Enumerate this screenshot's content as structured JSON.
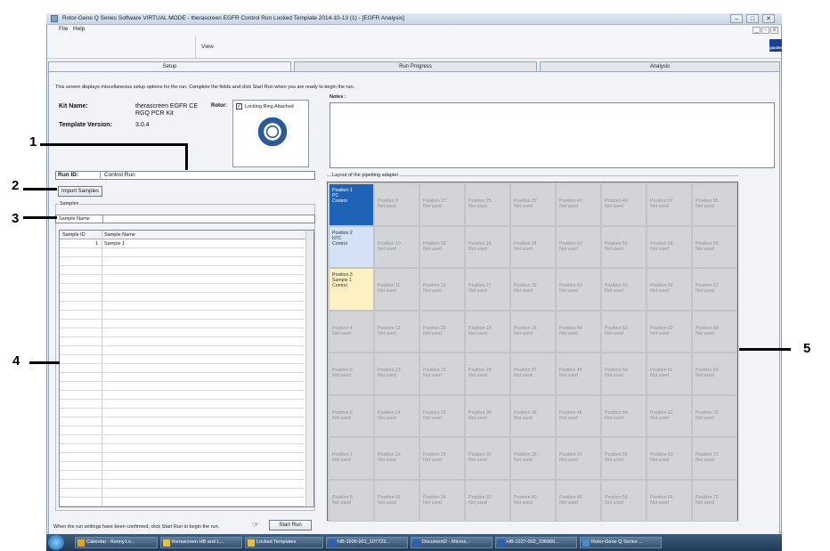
{
  "window": {
    "title": "Rotor-Gene Q Series Software VIRTUAL MODE - therascreen EGFR Control Run Locked Template 2014-10-13 (1) - [EGFR Analysis]",
    "minimize": "–",
    "maximize": "□",
    "close": "✕",
    "mdi_minimize": "_",
    "mdi_restore": "▫",
    "mdi_close": "x"
  },
  "menu": {
    "file": "File",
    "help": "Help"
  },
  "toolbar": {
    "view": "View",
    "qiagen": "QIAGEN"
  },
  "tabs": [
    {
      "label": "Setup"
    },
    {
      "label": "Run Progress"
    },
    {
      "label": "Analysis"
    }
  ],
  "setup": {
    "instruction": "This screen displays miscellaneous setup options for the run. Complete the fields and click Start Run when you are ready to begin the run.",
    "kit_name_label": "Kit Name:",
    "kit_name_value_1": "therascreen EGFR CE",
    "kit_name_value_2": "RGQ PCR Kit",
    "rotor_label": "Rotor:",
    "locking_ring_label": "Locking Ring Attached",
    "locking_ring_checked": "✓",
    "template_version_label": "Template Version:",
    "template_version_value": "3.0.4",
    "notes_label": "Notes :",
    "run_id_label": "Run ID:",
    "run_id_value": "Control Run",
    "import_samples": "Import Samples",
    "samples_group": "Samples",
    "sample_name_label": "Sample Name",
    "sample_name_value": "",
    "table_headers": [
      "Sample ID",
      "Sample Name"
    ],
    "table_rows": [
      {
        "id": "1",
        "name": "Sample 1"
      }
    ],
    "start_run_text": "When the run settings have been confirmed, click Start Run to begin the run.",
    "start_run_button": "Start Run",
    "layout_label": "Layout of the pipetting adapter"
  },
  "positions": [
    {
      "l1": "Position 1",
      "l2": "PC",
      "l3": "Control",
      "state": "c1"
    },
    {
      "l1": "Position 2",
      "l2": "NTC",
      "l3": "Control",
      "state": "c2"
    },
    {
      "l1": "Position 3",
      "l2": "Sample 1",
      "l3": "Control",
      "state": "c3"
    },
    {
      "l1": "Position 4",
      "l2": "Not used",
      "state": ""
    },
    {
      "l1": "Position 5",
      "l2": "Not used",
      "state": ""
    },
    {
      "l1": "Position 6",
      "l2": "Not used",
      "state": ""
    },
    {
      "l1": "Position 7",
      "l2": "Not used",
      "state": ""
    },
    {
      "l1": "Position 8",
      "l2": "Not used",
      "state": ""
    },
    {
      "l1": "Position 9",
      "l2": "Not used",
      "state": ""
    },
    {
      "l1": "Position 10",
      "l2": "Not used",
      "state": ""
    },
    {
      "l1": "Position 11",
      "l2": "Not used",
      "state": ""
    },
    {
      "l1": "Position 12",
      "l2": "Not used",
      "state": ""
    },
    {
      "l1": "Position 13",
      "l2": "Not used",
      "state": ""
    },
    {
      "l1": "Position 14",
      "l2": "Not used",
      "state": ""
    },
    {
      "l1": "Position 15",
      "l2": "Not used",
      "state": ""
    },
    {
      "l1": "Position 16",
      "l2": "Not used",
      "state": ""
    },
    {
      "l1": "Position 17",
      "l2": "Not used",
      "state": ""
    },
    {
      "l1": "Position 18",
      "l2": "Not used",
      "state": ""
    },
    {
      "l1": "Position 19",
      "l2": "Not used",
      "state": ""
    },
    {
      "l1": "Position 20",
      "l2": "Not used",
      "state": ""
    },
    {
      "l1": "Position 21",
      "l2": "Not used",
      "state": ""
    },
    {
      "l1": "Position 22",
      "l2": "Not used",
      "state": ""
    },
    {
      "l1": "Position 23",
      "l2": "Not used",
      "state": ""
    },
    {
      "l1": "Position 24",
      "l2": "Not used",
      "state": ""
    },
    {
      "l1": "Position 25",
      "l2": "Not used",
      "state": ""
    },
    {
      "l1": "Position 26",
      "l2": "Not used",
      "state": ""
    },
    {
      "l1": "Position 27",
      "l2": "Not used",
      "state": ""
    },
    {
      "l1": "Position 28",
      "l2": "Not used",
      "state": ""
    },
    {
      "l1": "Position 29",
      "l2": "Not used",
      "state": ""
    },
    {
      "l1": "Position 30",
      "l2": "Not used",
      "state": ""
    },
    {
      "l1": "Position 31",
      "l2": "Not used",
      "state": ""
    },
    {
      "l1": "Position 32",
      "l2": "Not used",
      "state": ""
    },
    {
      "l1": "Position 33",
      "l2": "Not used",
      "state": ""
    },
    {
      "l1": "Position 34",
      "l2": "Not used",
      "state": ""
    },
    {
      "l1": "Position 35",
      "l2": "Not used",
      "state": ""
    },
    {
      "l1": "Position 36",
      "l2": "Not used",
      "state": ""
    },
    {
      "l1": "Position 37",
      "l2": "Not used",
      "state": ""
    },
    {
      "l1": "Position 38",
      "l2": "Not used",
      "state": ""
    },
    {
      "l1": "Position 39",
      "l2": "Not used",
      "state": ""
    },
    {
      "l1": "Position 40",
      "l2": "Not used",
      "state": ""
    },
    {
      "l1": "Position 41",
      "l2": "Not used",
      "state": ""
    },
    {
      "l1": "Position 42",
      "l2": "Not used",
      "state": ""
    },
    {
      "l1": "Position 43",
      "l2": "Not used",
      "state": ""
    },
    {
      "l1": "Position 44",
      "l2": "Not used",
      "state": ""
    },
    {
      "l1": "Position 45",
      "l2": "Not used",
      "state": ""
    },
    {
      "l1": "Position 46",
      "l2": "Not used",
      "state": ""
    },
    {
      "l1": "Position 47",
      "l2": "Not used",
      "state": ""
    },
    {
      "l1": "Position 48",
      "l2": "Not used",
      "state": ""
    },
    {
      "l1": "Position 49",
      "l2": "Not used",
      "state": ""
    },
    {
      "l1": "Position 50",
      "l2": "Not used",
      "state": ""
    },
    {
      "l1": "Position 51",
      "l2": "Not used",
      "state": ""
    },
    {
      "l1": "Position 52",
      "l2": "Not used",
      "state": ""
    },
    {
      "l1": "Position 53",
      "l2": "Not used",
      "state": ""
    },
    {
      "l1": "Position 54",
      "l2": "Not used",
      "state": ""
    },
    {
      "l1": "Position 55",
      "l2": "Not used",
      "state": ""
    },
    {
      "l1": "Position 56",
      "l2": "Not used",
      "state": ""
    },
    {
      "l1": "Position 57",
      "l2": "Not used",
      "state": ""
    },
    {
      "l1": "Position 58",
      "l2": "Not used",
      "state": ""
    },
    {
      "l1": "Position 59",
      "l2": "Not used",
      "state": ""
    },
    {
      "l1": "Position 60",
      "l2": "Not used",
      "state": ""
    },
    {
      "l1": "Position 61",
      "l2": "Not used",
      "state": ""
    },
    {
      "l1": "Position 62",
      "l2": "Not used",
      "state": ""
    },
    {
      "l1": "Position 63",
      "l2": "Not used",
      "state": ""
    },
    {
      "l1": "Position 64",
      "l2": "Not used",
      "state": ""
    },
    {
      "l1": "Position 65",
      "l2": "Not used",
      "state": ""
    },
    {
      "l1": "Position 66",
      "l2": "Not used",
      "state": ""
    },
    {
      "l1": "Position 67",
      "l2": "Not used",
      "state": ""
    },
    {
      "l1": "Position 68",
      "l2": "Not used",
      "state": ""
    },
    {
      "l1": "Position 69",
      "l2": "Not used",
      "state": ""
    },
    {
      "l1": "Position 70",
      "l2": "Not used",
      "state": ""
    },
    {
      "l1": "Position 71",
      "l2": "Not used",
      "state": ""
    },
    {
      "l1": "Position 72",
      "l2": "Not used",
      "state": ""
    }
  ],
  "callouts": [
    "1",
    "2",
    "3",
    "4",
    "5"
  ],
  "taskbar": [
    {
      "label": "Calendar - Kenny.Lo...",
      "icon": "outlook-icon",
      "color": "#e8a020"
    },
    {
      "label": "therascreen HB and L...",
      "icon": "folder-icon",
      "color": "#e8c040"
    },
    {
      "label": "Locked Templates",
      "icon": "folder-icon",
      "color": "#e8c040"
    },
    {
      "label": "HB-1605-001_107723...",
      "icon": "word-icon",
      "color": "#2b5fb8"
    },
    {
      "label": "Document2 - Micros...",
      "icon": "word-icon",
      "color": "#2b5fb8"
    },
    {
      "label": "HB-1227-002_106960...",
      "icon": "word-icon",
      "color": "#2b5fb8"
    },
    {
      "label": "Rotor-Gene Q Series ...",
      "icon": "rotorgene-icon",
      "color": "#4a8ad0"
    }
  ]
}
